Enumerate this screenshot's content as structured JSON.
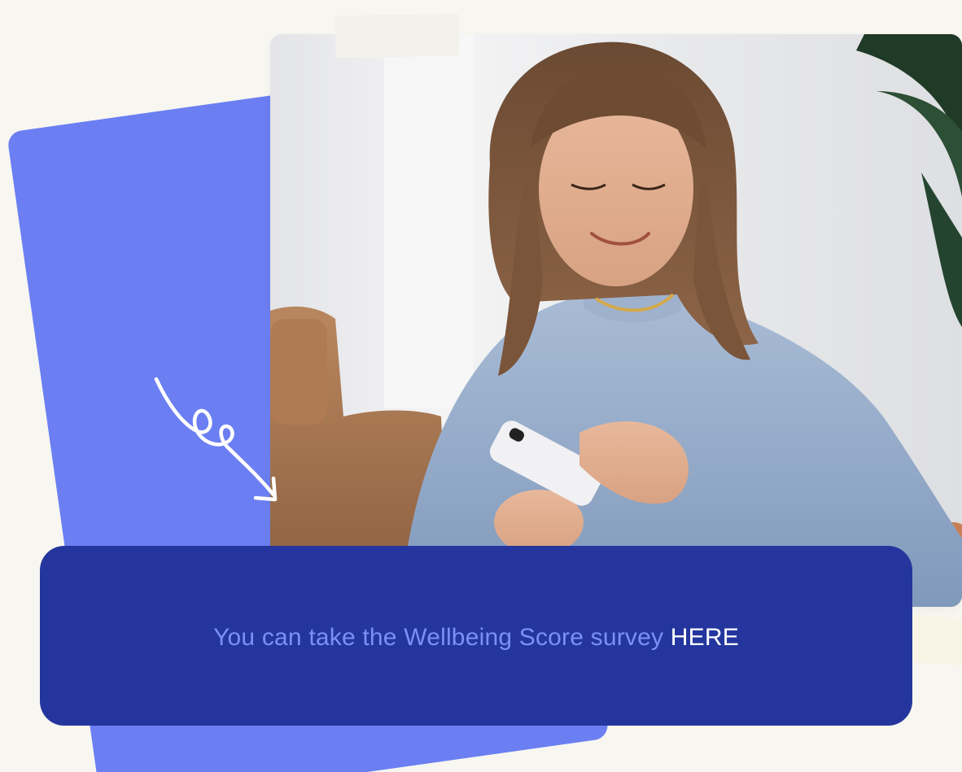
{
  "colors": {
    "background": "#f7f6f1",
    "card_blue": "#6b7ff2",
    "panel_navy": "#24369e",
    "cta_text": "#7b8ff8",
    "cta_link": "#ffffff",
    "tape_white": "#f2f1ec",
    "tape_lavender": "#a3acd8",
    "tape_cream": "#f9f5e6"
  },
  "cta": {
    "text": "You can take the Wellbeing Score survey ",
    "link_label": "HERE"
  },
  "photo": {
    "subject": "woman-using-smartphone"
  },
  "decorations": {
    "scribble_icon": "hand-drawn-arrow-icon"
  }
}
